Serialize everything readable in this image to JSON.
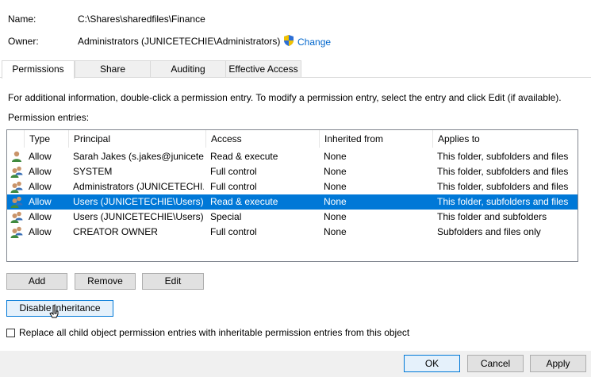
{
  "header": {
    "name_label": "Name:",
    "name_value": "C:\\Shares\\sharedfiles\\Finance",
    "owner_label": "Owner:",
    "owner_value": "Administrators (JUNICETECHIE\\Administrators)",
    "change_link": "Change",
    "change_icon": "uac-shield-icon"
  },
  "tabs": [
    {
      "label": "Permissions",
      "active": true
    },
    {
      "label": "Share",
      "active": false
    },
    {
      "label": "Auditing",
      "active": false
    },
    {
      "label": "Effective Access",
      "active": false
    }
  ],
  "info_text": "For additional information, double-click a permission entry. To modify a permission entry, select the entry and click Edit (if available).",
  "entries_label": "Permission entries:",
  "columns": [
    "Type",
    "Principal",
    "Access",
    "Inherited from",
    "Applies to"
  ],
  "entries": [
    {
      "icon": "user-icon",
      "type": "Allow",
      "principal": "Sarah Jakes (s.jakes@junicete...",
      "access": "Read & execute",
      "inherited": "None",
      "applies": "This folder, subfolders and files",
      "selected": false
    },
    {
      "icon": "group-icon",
      "type": "Allow",
      "principal": "SYSTEM",
      "access": "Full control",
      "inherited": "None",
      "applies": "This folder, subfolders and files",
      "selected": false
    },
    {
      "icon": "group-icon",
      "type": "Allow",
      "principal": "Administrators (JUNICETECHI...",
      "access": "Full control",
      "inherited": "None",
      "applies": "This folder, subfolders and files",
      "selected": false
    },
    {
      "icon": "group-icon",
      "type": "Allow",
      "principal": "Users (JUNICETECHIE\\Users)",
      "access": "Read & execute",
      "inherited": "None",
      "applies": "This folder, subfolders and files",
      "selected": true
    },
    {
      "icon": "group-icon",
      "type": "Allow",
      "principal": "Users (JUNICETECHIE\\Users)",
      "access": "Special",
      "inherited": "None",
      "applies": "This folder and subfolders",
      "selected": false
    },
    {
      "icon": "group-icon",
      "type": "Allow",
      "principal": "CREATOR OWNER",
      "access": "Full control",
      "inherited": "None",
      "applies": "Subfolders and files only",
      "selected": false
    }
  ],
  "buttons": {
    "add": "Add",
    "remove": "Remove",
    "edit": "Edit",
    "disable_inheritance": "Disable inheritance"
  },
  "replace_checkbox": {
    "label": "Replace all child object permission entries with inheritable permission entries from this object",
    "checked": false
  },
  "footer": {
    "ok": "OK",
    "cancel": "Cancel",
    "apply": "Apply"
  },
  "colors": {
    "selection": "#0078d7",
    "link": "#0066cc",
    "button_bg": "#e1e1e1"
  }
}
